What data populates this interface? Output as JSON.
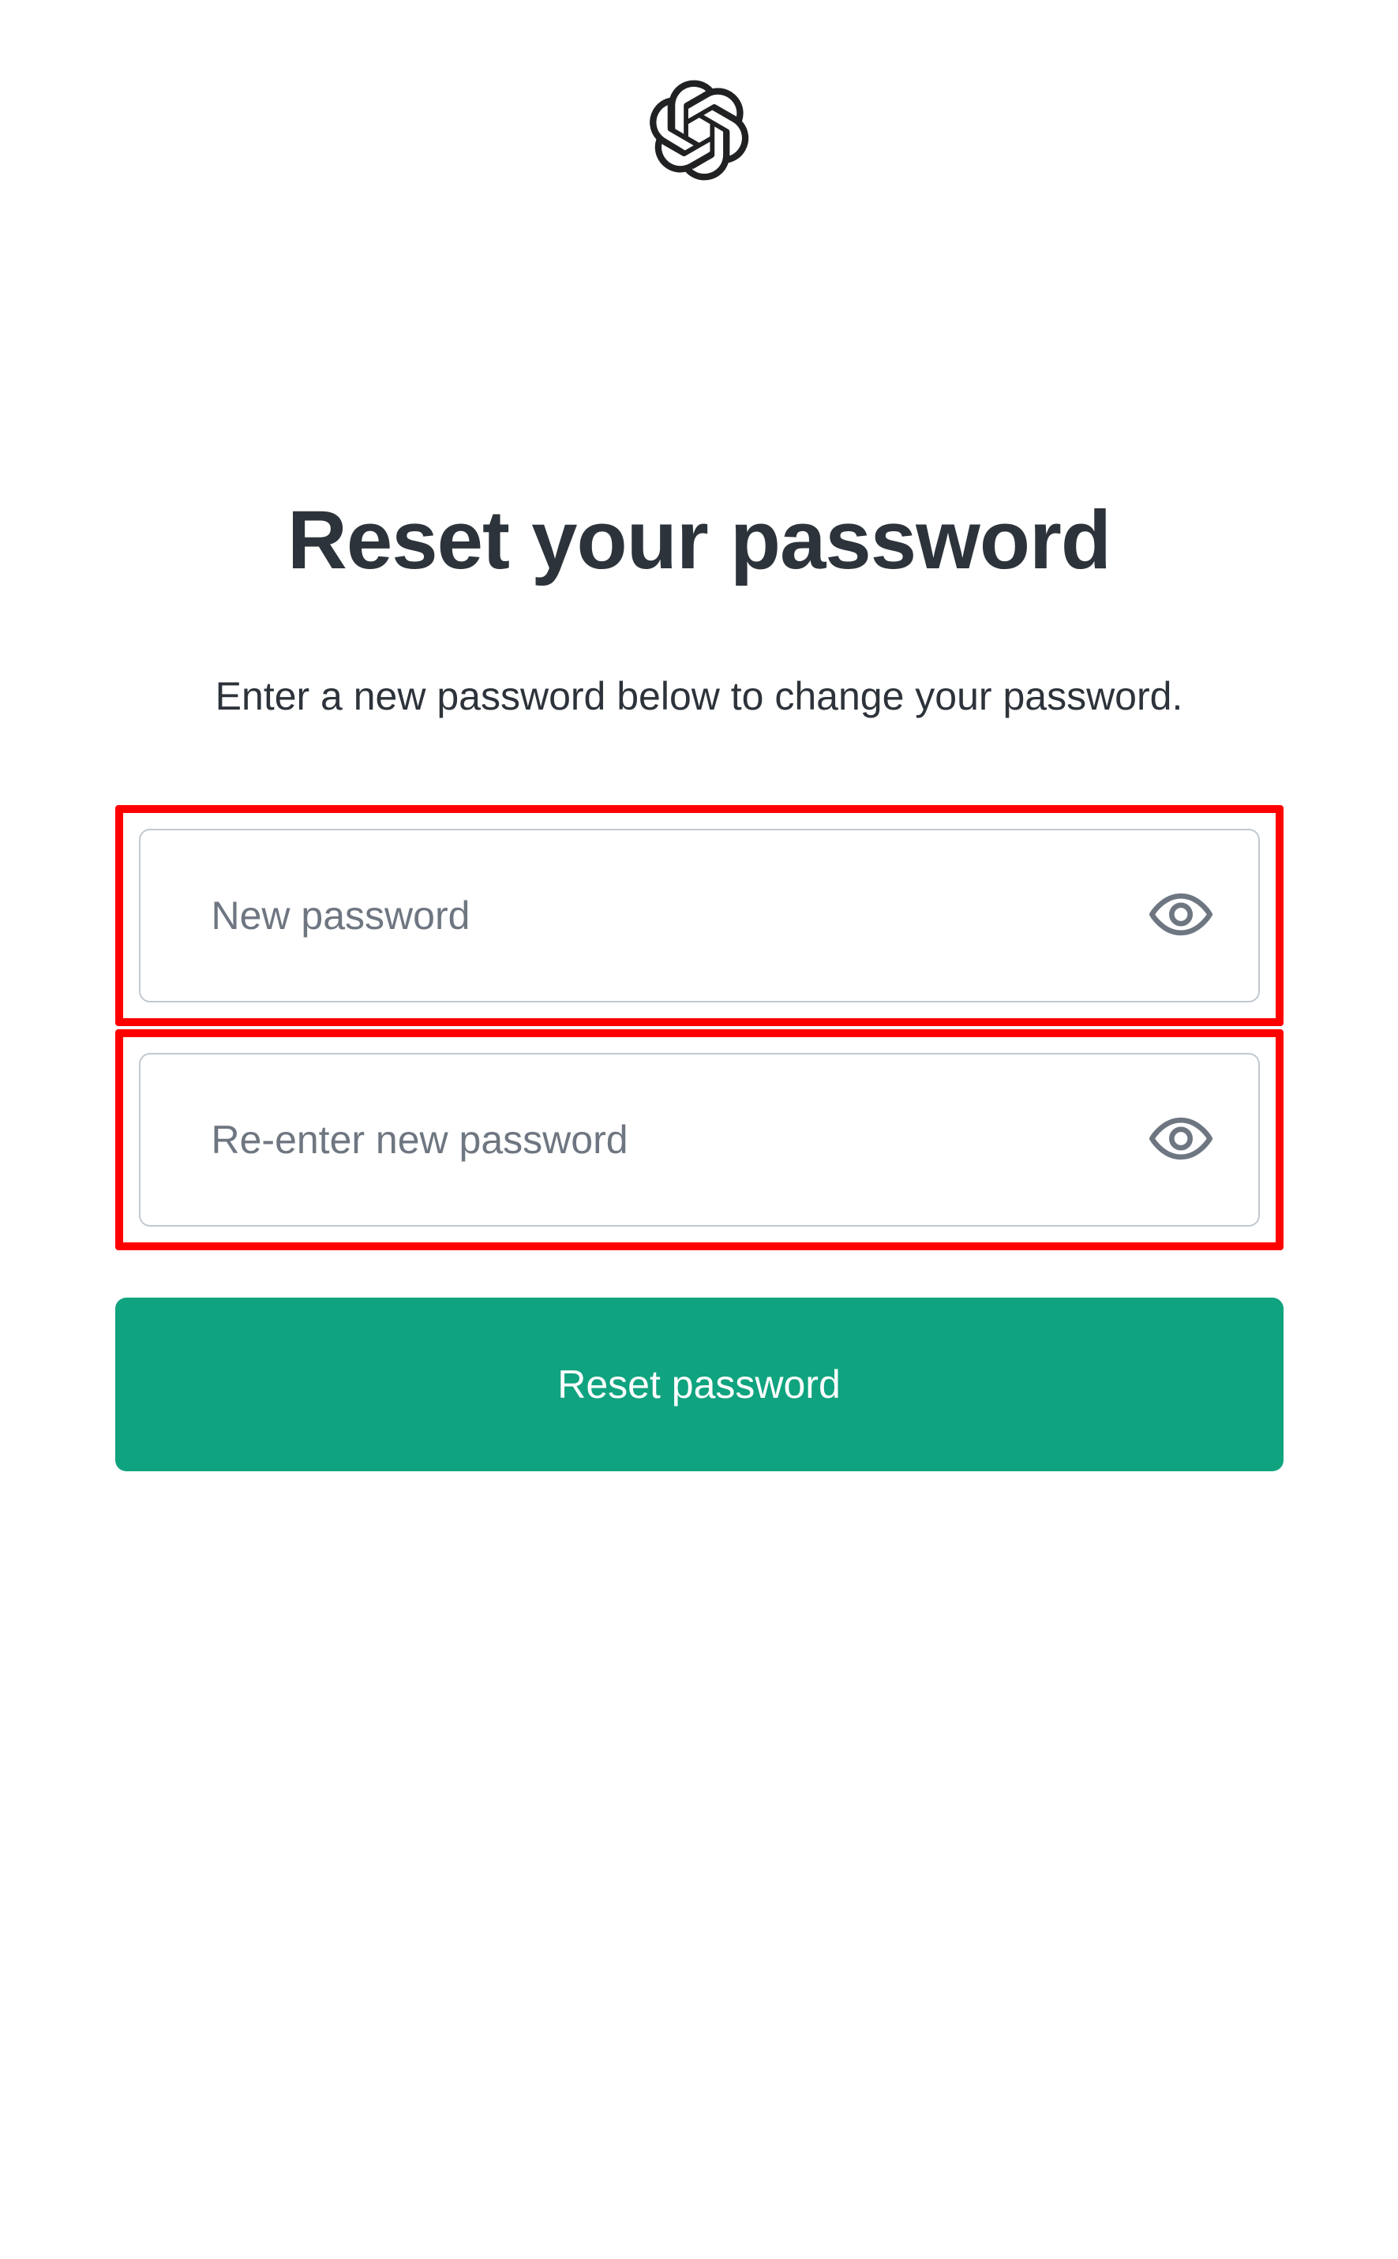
{
  "logo": {
    "name": "openai-logo"
  },
  "page": {
    "title": "Reset your password",
    "subtitle": "Enter a new password below to change your password."
  },
  "form": {
    "new_password": {
      "placeholder": "New password",
      "value": ""
    },
    "confirm_password": {
      "placeholder": "Re-enter new password",
      "value": ""
    },
    "submit_label": "Reset password"
  },
  "colors": {
    "accent": "#10a37f",
    "highlight_border": "#ff0000",
    "text_primary": "#2d333a",
    "text_muted": "#6e7681",
    "input_border": "#c2c8d0"
  }
}
